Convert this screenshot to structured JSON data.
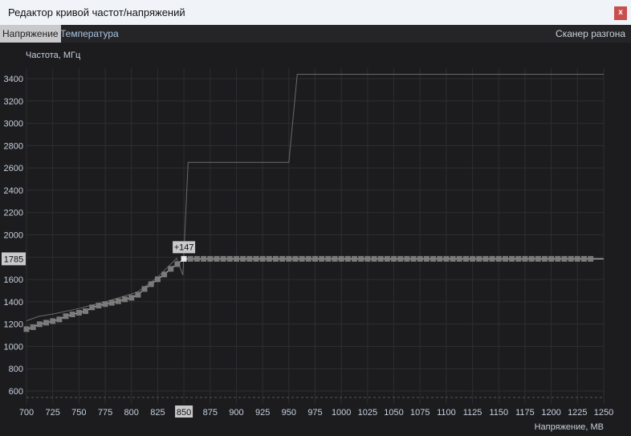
{
  "window": {
    "title": "Редактор кривой частот/напряжений",
    "close_label": "x"
  },
  "tabs": [
    {
      "label": "Напряжение",
      "active": true
    },
    {
      "label": "Температура",
      "active": false
    }
  ],
  "scanner_label": "Сканер разгона",
  "chart_data": {
    "type": "line",
    "xlabel": "Напряжение, МВ",
    "ylabel": "Частота, МГц",
    "xlim": [
      700,
      1250
    ],
    "ylim": [
      600,
      3400
    ],
    "x_ticks": [
      700,
      725,
      750,
      775,
      800,
      825,
      850,
      875,
      900,
      925,
      950,
      975,
      1000,
      1025,
      1050,
      1075,
      1100,
      1125,
      1150,
      1175,
      1200,
      1225,
      1250
    ],
    "y_ticks": [
      3400,
      3200,
      3000,
      2800,
      2600,
      2400,
      2200,
      2000,
      1800,
      1600,
      1400,
      1200,
      1000,
      800,
      600
    ],
    "grid": true,
    "selected": {
      "voltage": 850,
      "frequency": 1785,
      "offset_label": "+147",
      "y_readout": "1785",
      "x_readout": "850"
    },
    "curve_points": [
      [
        700,
        1155
      ],
      [
        706.25,
        1172
      ],
      [
        712.5,
        1199
      ],
      [
        718.75,
        1213
      ],
      [
        725,
        1227
      ],
      [
        731.25,
        1242
      ],
      [
        737.5,
        1271
      ],
      [
        743.75,
        1287
      ],
      [
        750,
        1302
      ],
      [
        756.25,
        1316
      ],
      [
        762.5,
        1350
      ],
      [
        768.75,
        1366
      ],
      [
        775,
        1379
      ],
      [
        781.25,
        1391
      ],
      [
        787.5,
        1405
      ],
      [
        793.75,
        1422
      ],
      [
        800,
        1436
      ],
      [
        806.25,
        1463
      ],
      [
        812.5,
        1515
      ],
      [
        818.75,
        1558
      ],
      [
        825,
        1602
      ],
      [
        831.25,
        1645
      ],
      [
        837.5,
        1695
      ],
      [
        843.75,
        1738
      ],
      [
        850,
        1785
      ]
    ],
    "flat_segment": {
      "from": 856.25,
      "to": 1237.5,
      "step": 6.25,
      "frequency": 1785,
      "line_end": 1250
    },
    "reference_line": [
      [
        700,
        1230
      ],
      [
        712,
        1270
      ],
      [
        725,
        1290
      ],
      [
        750,
        1340
      ],
      [
        775,
        1400
      ],
      [
        800,
        1470
      ],
      [
        806,
        1490
      ],
      [
        812,
        1530
      ],
      [
        825,
        1620
      ],
      [
        843,
        1790
      ],
      [
        849,
        1640
      ],
      [
        854,
        2650
      ],
      [
        950,
        2650
      ],
      [
        958,
        3440
      ],
      [
        1250,
        3440
      ]
    ],
    "colors": {
      "background": "#1c1c1e",
      "grid": "#2e2e31",
      "point": "#7a7a7a",
      "selected_point": "#e8e8e8",
      "curve": "#e0e0e0",
      "reference": "#6a6a6a"
    }
  }
}
